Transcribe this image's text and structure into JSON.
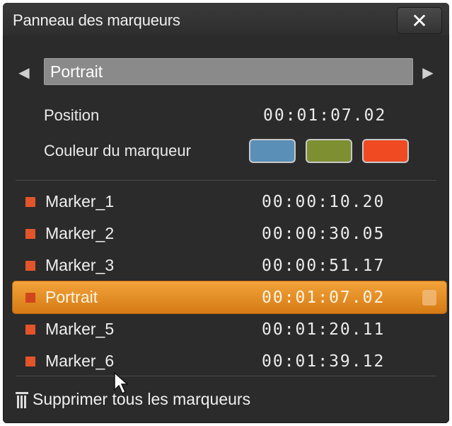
{
  "window": {
    "title": "Panneau des marqueurs",
    "close_label": "✕"
  },
  "nav": {
    "prev_icon": "arrow-left-icon",
    "next_icon": "arrow-right-icon",
    "name_value": "Portrait"
  },
  "fields": {
    "position_label": "Position",
    "position_value": "00:01:07.02",
    "color_label": "Couleur du marqueur"
  },
  "colors": {
    "swatch_blue": "#5a8fb8",
    "swatch_green": "#7e8f32",
    "swatch_red": "#f04a22",
    "marker_bullet": "#e2552a",
    "selected_row": "#e38a1f"
  },
  "markers": [
    {
      "name": "Marker_1",
      "time": "00:00:10.20"
    },
    {
      "name": "Marker_2",
      "time": "00:00:30.05"
    },
    {
      "name": "Marker_3",
      "time": "00:00:51.17"
    },
    {
      "name": "Portrait",
      "time": "00:01:07.02",
      "selected": true
    },
    {
      "name": "Marker_5",
      "time": "00:01:20.11"
    },
    {
      "name": "Marker_6",
      "time": "00:01:39.12"
    }
  ],
  "footer": {
    "delete_all_label": "Supprimer tous les marqueurs"
  }
}
